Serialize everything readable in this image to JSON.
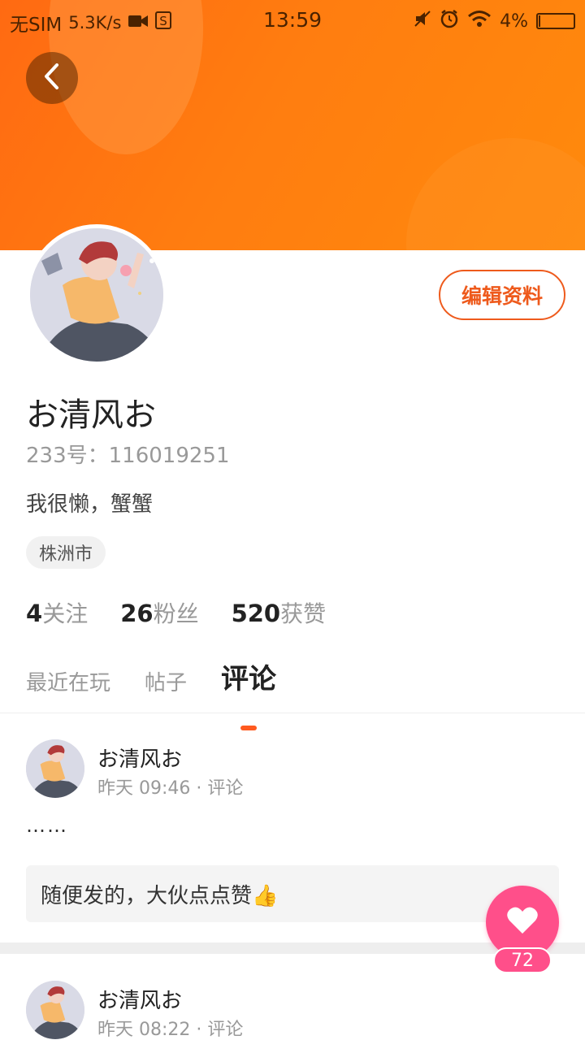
{
  "status_bar": {
    "carrier": "无SIM",
    "speed": "5.3K/s",
    "time": "13:59",
    "battery": "4%",
    "battery_level": 0.04
  },
  "header": {
    "back_icon": "chevron-left-icon"
  },
  "profile": {
    "edit_label": "编辑资料",
    "username": "お清风お",
    "uid": "233号：116019251",
    "bio": "我很懒，蟹蟹",
    "location": "株洲市",
    "stats": [
      {
        "num": "4",
        "label": "关注"
      },
      {
        "num": "26",
        "label": "粉丝"
      },
      {
        "num": "520",
        "label": "获赞"
      }
    ]
  },
  "tabs": [
    {
      "label": "最近在玩",
      "active": false
    },
    {
      "label": "帖子",
      "active": false
    },
    {
      "label": "评论",
      "active": true
    }
  ],
  "posts": [
    {
      "author": "お清风お",
      "meta": "昨天 09:46 · 评论",
      "body": "……",
      "quote": "随便发的，大伙点点赞👍"
    },
    {
      "author": "お清风お",
      "meta": "昨天 08:22 · 评论"
    }
  ],
  "like": {
    "count": "72"
  },
  "colors": {
    "accent": "#ee5a1c",
    "banner": "#ff7d10",
    "like": "#ff4f8a"
  }
}
